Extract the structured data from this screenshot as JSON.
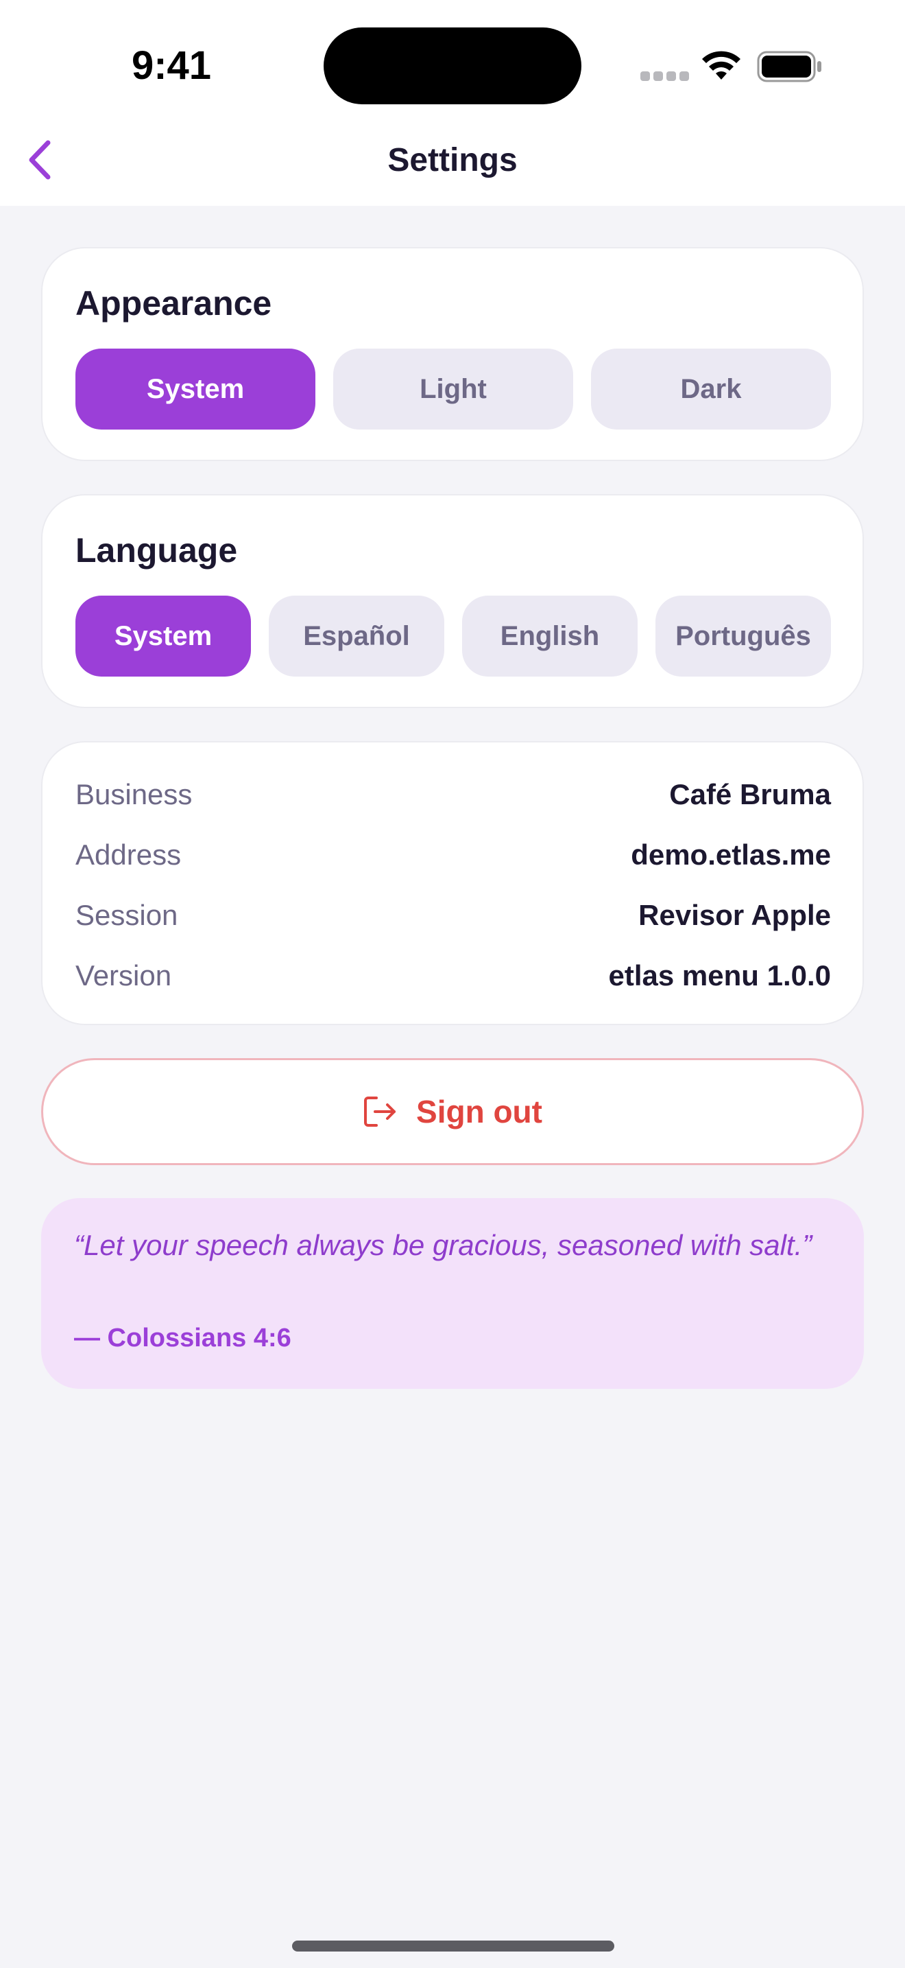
{
  "status_bar": {
    "time": "9:41"
  },
  "header": {
    "title": "Settings",
    "back_icon": "chevron-left-icon"
  },
  "appearance": {
    "title": "Appearance",
    "options": [
      "System",
      "Light",
      "Dark"
    ],
    "selected": "System"
  },
  "language": {
    "title": "Language",
    "options": [
      "System",
      "Español",
      "English",
      "Português"
    ],
    "selected": "System"
  },
  "info": {
    "rows": [
      {
        "label": "Business",
        "value": "Café Bruma"
      },
      {
        "label": "Address",
        "value": "demo.etlas.me"
      },
      {
        "label": "Session",
        "value": "Revisor Apple"
      },
      {
        "label": "Version",
        "value": "etlas menu 1.0.0"
      }
    ]
  },
  "signout": {
    "label": "Sign out",
    "icon": "sign-out-icon"
  },
  "quote": {
    "text": "“Let your speech always be gracious, seasoned with salt.”",
    "reference": "— Colossians 4:6"
  },
  "colors": {
    "accent": "#9b3fd8",
    "danger": "#e0453f",
    "quote_bg": "#f3e1fa",
    "background": "#f4f4f8"
  }
}
